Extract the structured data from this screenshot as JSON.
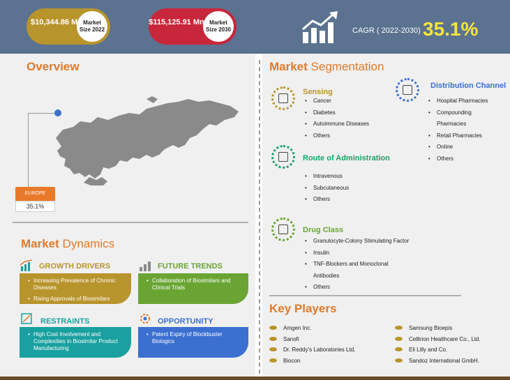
{
  "header": {
    "size_2022_value": "$10,344.86 Mn",
    "size_2022_label": "Market Size 2022",
    "size_2030_value": "$115,125.91 Mn",
    "size_2030_label": "Market Size 2030",
    "cagr_label": "CAGR ( 2022-2030)",
    "cagr_value": "35.1%",
    "colors": {
      "gold": "#b8942c",
      "red": "#c8263a",
      "banner": "#5b7290",
      "cagr": "#f6e43c"
    }
  },
  "overview": {
    "title_a": "Overview",
    "region_label": "EUROPE",
    "region_value": "35.1%"
  },
  "dynamics": {
    "title_a": "Market",
    "title_b": "Dynamics",
    "growth": {
      "title": "GROWTH DRIVERS",
      "items": [
        "Increasing Prevalence of Chronic Diseases",
        "Rising Approvals of Biosimilars"
      ]
    },
    "trends": {
      "title": "FUTURE TRENDS",
      "items": [
        "Collaboration of Biosimilars and Clinical Trials"
      ]
    },
    "restraints": {
      "title": "RESTRAINTS",
      "items": [
        "High Cost Involvement and Complexities in Biosimilar Product Manufacturing"
      ]
    },
    "opportunity": {
      "title": "OPPORTUNITY",
      "items": [
        "Patent Expiry of Blockbuster Biologics"
      ]
    }
  },
  "segmentation": {
    "title_a": "Market",
    "title_b": "Segmentation",
    "sensing": {
      "title": "Sensing",
      "items": [
        "Cancer",
        "Diabetes",
        "Autoimmune Diseases",
        "Others"
      ]
    },
    "distribution": {
      "title": "Distribution Channel",
      "items": [
        "Hospital Pharmacies",
        "Compounding Pharmacies",
        "Retail Pharmacies",
        "Online",
        "Others"
      ]
    },
    "route": {
      "title": "Route of Administration",
      "items": [
        "Intravenous",
        "Subcutaneous",
        "Others"
      ]
    },
    "drug": {
      "title": "Drug Class",
      "items": [
        "Granulocyte-Colony Stimulating Factor",
        "Insulin",
        "TNF-Blockers and Monoclonal Antibodies",
        "Others"
      ]
    }
  },
  "key_players": {
    "title": "Key Players",
    "left": [
      "Amgen Inc.",
      "Sanofi",
      "Dr. Reddy's Laboratories Ltd.",
      "Biocon"
    ],
    "right": [
      "Samsung Bioepis",
      "Celltrion Healthcare Co., Ltd.",
      "Eli Lilly and Co.",
      "Sandoz International GmbH."
    ]
  }
}
